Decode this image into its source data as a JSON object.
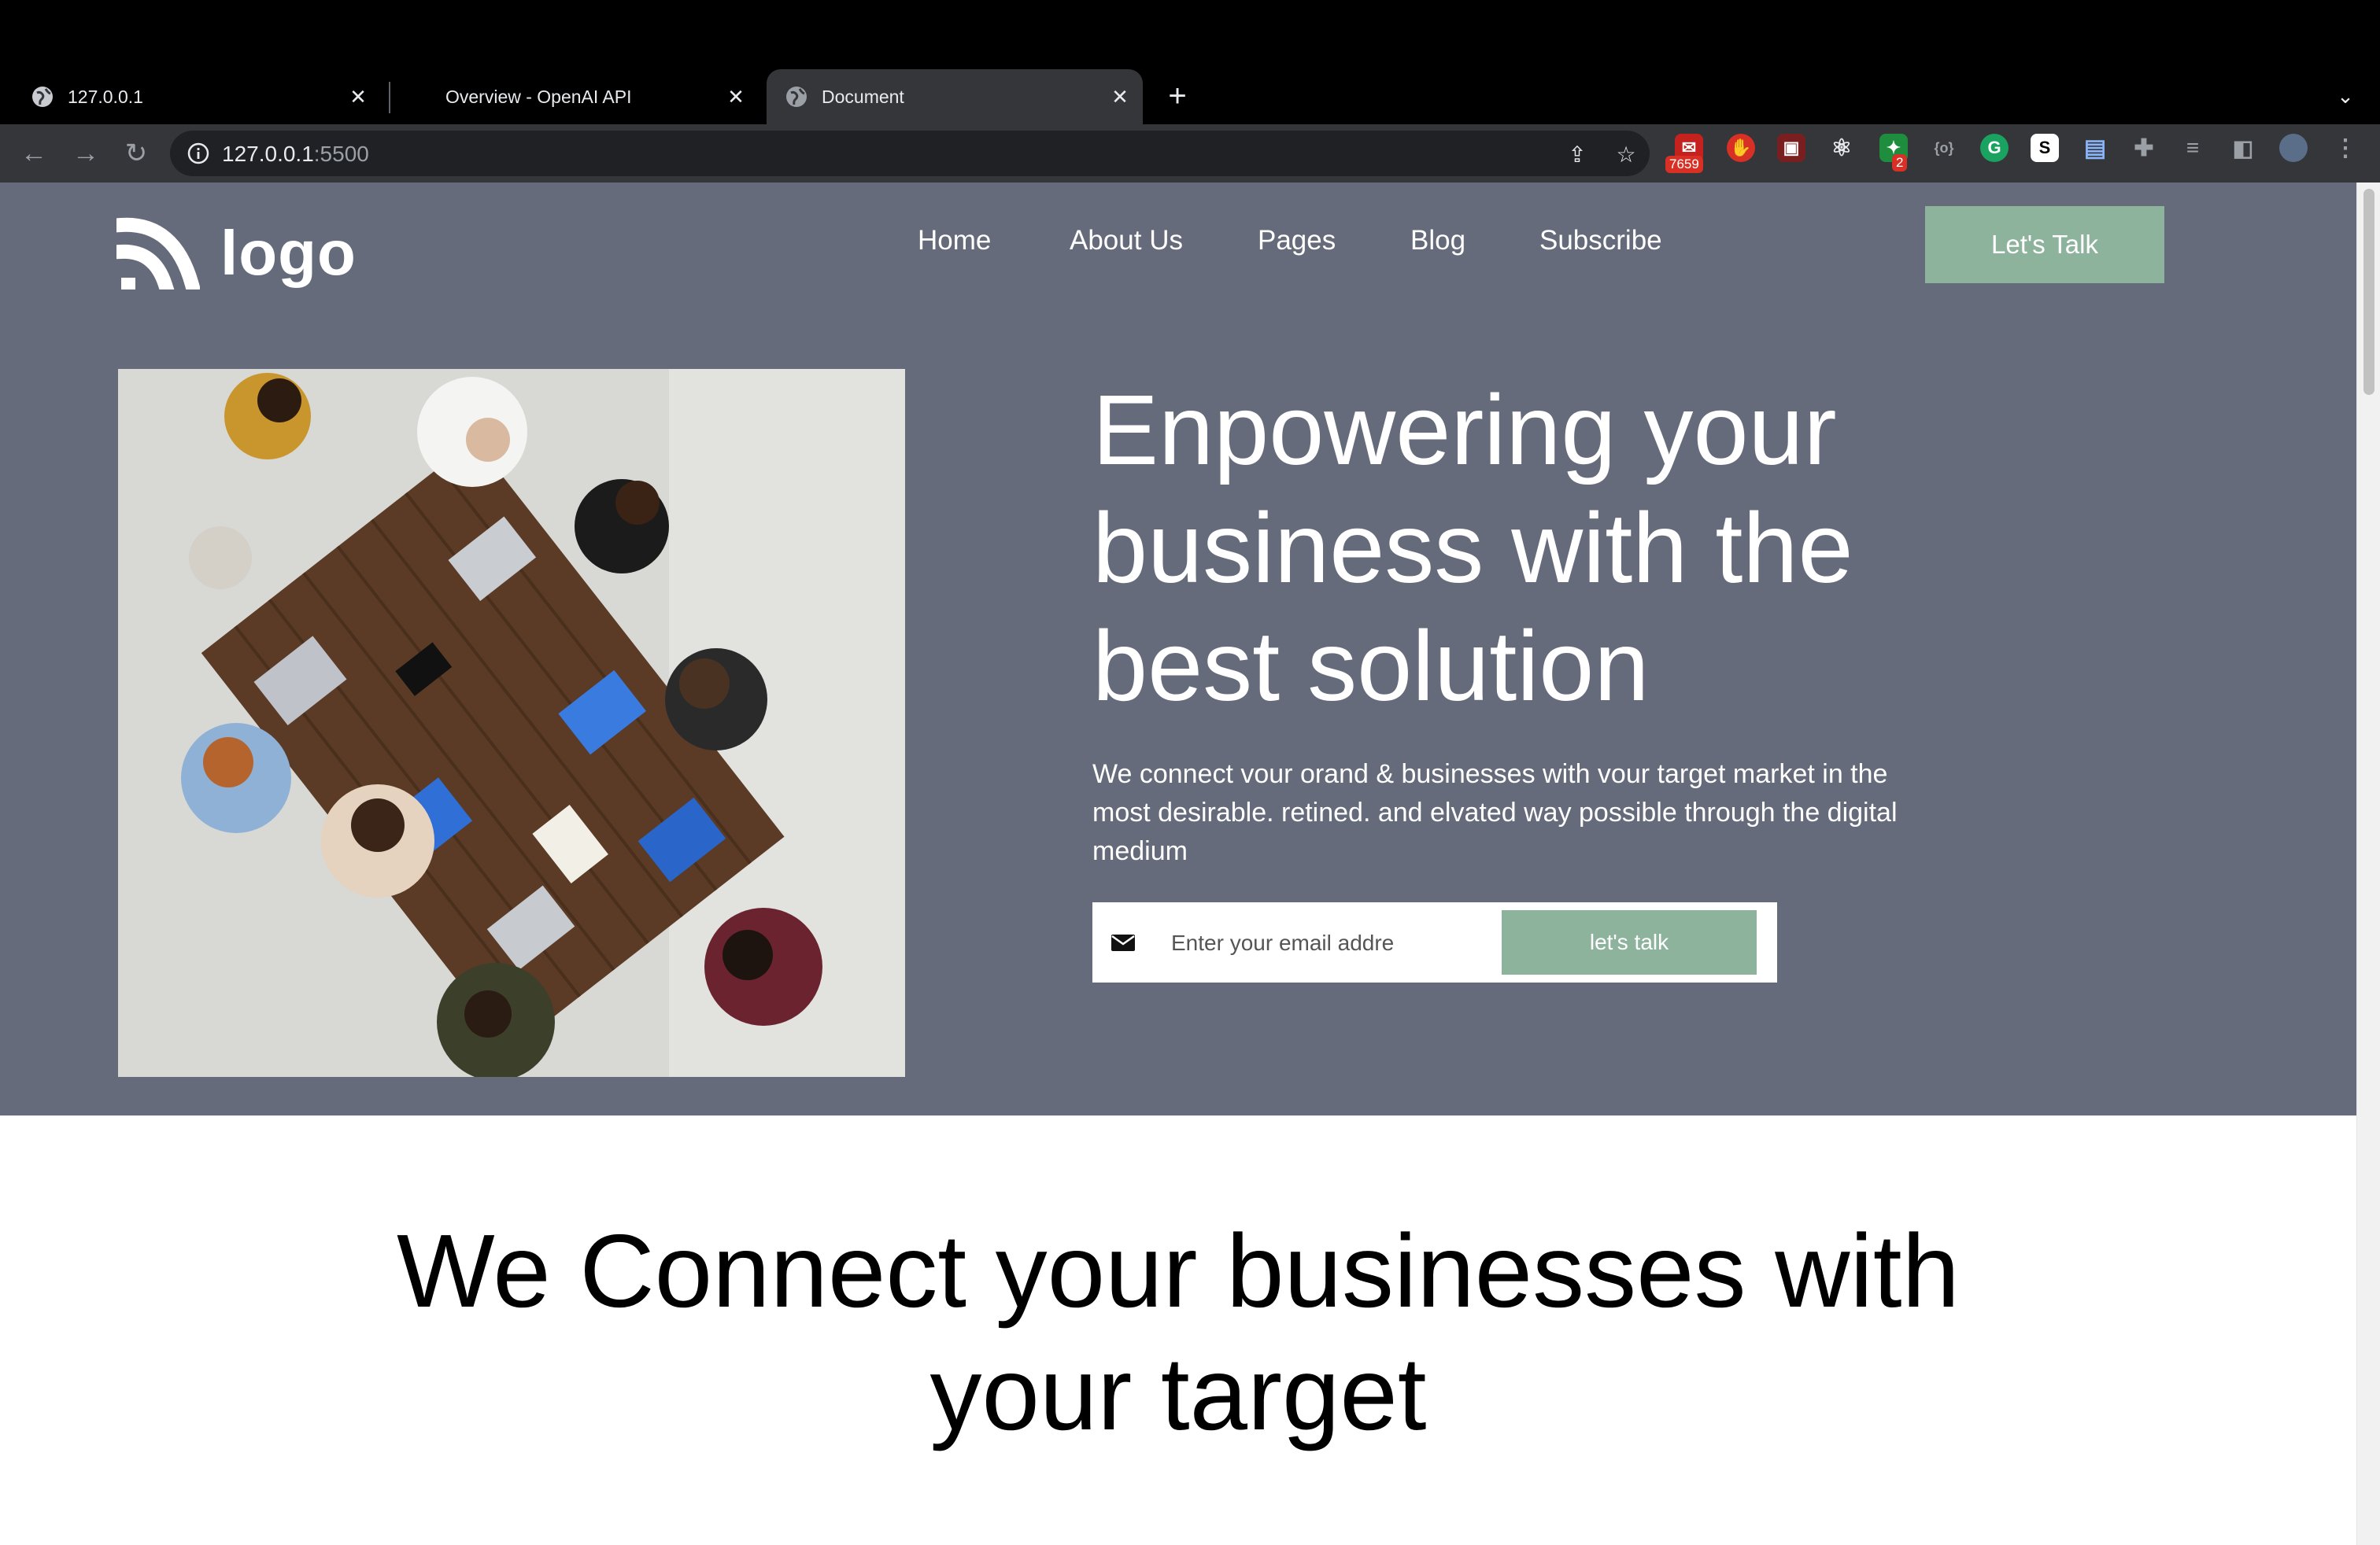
{
  "browser": {
    "tabs": [
      {
        "title": "127.0.0.1",
        "active": false
      },
      {
        "title": "Overview - OpenAI API",
        "active": false
      },
      {
        "title": "Document",
        "active": true
      }
    ],
    "address": {
      "host": "127.0.0.1",
      "port": ":5500"
    },
    "extensions": {
      "mail_badge": "7659",
      "ext_badge": "2"
    }
  },
  "site": {
    "logo_text": "logo",
    "nav": [
      "Home",
      "About Us",
      "Pages",
      "Blog",
      "Subscribe"
    ],
    "cta_label": "Let's Talk",
    "hero": {
      "headline": "Enpowering your business with the best solution",
      "subtext": "We connect vour orand & businesses with vour target market in the most desirable. retined. and elvated way possible through the digital medium",
      "email_placeholder": "Enter your email addre",
      "submit_label": "let's talk"
    },
    "section2_title": "We Connect your businesses with your target"
  },
  "colors": {
    "hero_bg": "#656b7a",
    "accent_green": "#8db39d",
    "chrome_dark": "#35363a"
  }
}
